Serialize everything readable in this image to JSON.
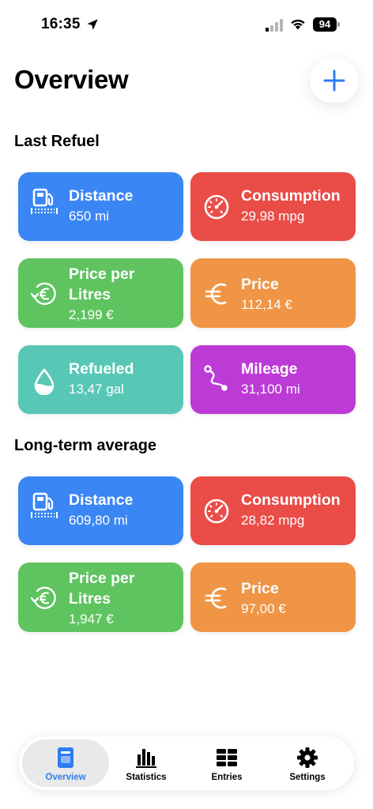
{
  "status_bar": {
    "time": "16:35",
    "battery": "94"
  },
  "header": {
    "title": "Overview",
    "add_icon": "plus-icon"
  },
  "sections": {
    "last_refuel": {
      "title": "Last Refuel",
      "cards": [
        {
          "label": "Distance",
          "value": "650 mi",
          "icon": "fuel-pump-icon",
          "color": "#3b86f5"
        },
        {
          "label": "Consumption",
          "value": "29,98 mpg",
          "icon": "speedometer-icon",
          "color": "#ea4c48"
        },
        {
          "label": "Price per Litres",
          "value": "2,199 €",
          "icon": "euro-refresh-icon",
          "color": "#5fc460"
        },
        {
          "label": "Price",
          "value": "112,14 €",
          "icon": "euro-icon",
          "color": "#f09545"
        },
        {
          "label": "Refueled",
          "value": "13,47 gal",
          "icon": "drop-icon",
          "color": "#58c7b6"
        },
        {
          "label": "Mileage",
          "value": "31,100 mi",
          "icon": "route-icon",
          "color": "#bc3bd6"
        }
      ]
    },
    "long_term": {
      "title": "Long-term average",
      "cards": [
        {
          "label": "Distance",
          "value": "609,80 mi",
          "icon": "fuel-pump-icon",
          "color": "#3b86f5"
        },
        {
          "label": "Consumption",
          "value": "28,82 mpg",
          "icon": "speedometer-icon",
          "color": "#ea4c48"
        },
        {
          "label": "Price per Litres",
          "value": "1,947 €",
          "icon": "euro-refresh-icon",
          "color": "#5fc460"
        },
        {
          "label": "Price",
          "value": "97,00 €",
          "icon": "euro-icon",
          "color": "#f09545"
        }
      ]
    }
  },
  "tab_bar": {
    "tabs": [
      {
        "label": "Overview",
        "icon": "document-icon",
        "active": true
      },
      {
        "label": "Statistics",
        "icon": "bar-chart-icon",
        "active": false
      },
      {
        "label": "Entries",
        "icon": "table-icon",
        "active": false
      },
      {
        "label": "Settings",
        "icon": "gear-icon",
        "active": false
      }
    ]
  }
}
